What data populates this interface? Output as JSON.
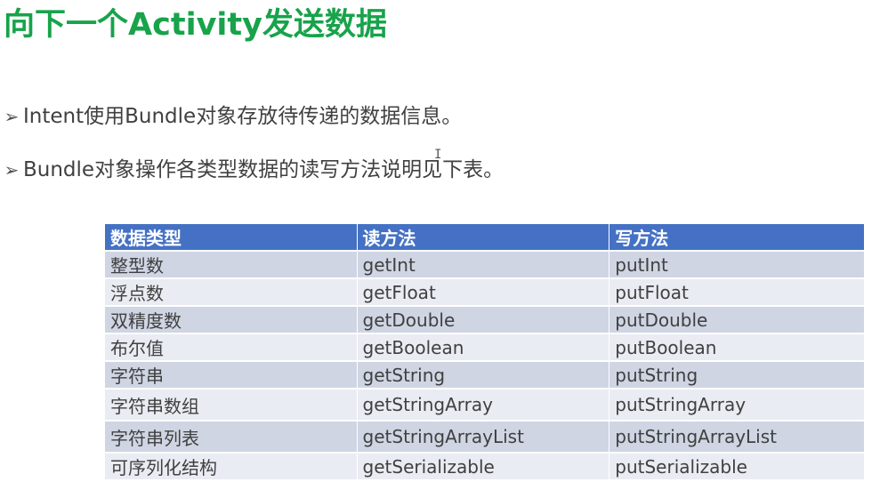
{
  "title": "向下一个Activity发送数据",
  "bullets": [
    {
      "marker": "➢",
      "text": "Intent使用Bundle对象存放待传递的数据信息。"
    },
    {
      "marker": "➢",
      "text": "Bundle对象操作各类型数据的读写方法说明见下表。"
    }
  ],
  "cursor_glyph": "I",
  "table": {
    "headers": [
      "数据类型",
      "读方法",
      "写方法"
    ],
    "rows": [
      [
        "整型数",
        "getInt",
        "putInt"
      ],
      [
        "浮点数",
        "getFloat",
        "putFloat"
      ],
      [
        "双精度数",
        "getDouble",
        "putDouble"
      ],
      [
        "布尔值",
        "getBoolean",
        "putBoolean"
      ],
      [
        "字符串",
        "getString",
        "putString"
      ],
      [
        "字符串数组",
        "getStringArray",
        "putStringArray"
      ],
      [
        "字符串列表",
        "getStringArrayList",
        "putStringArrayList"
      ],
      [
        "可序列化结构",
        "getSerializable",
        "putSerializable"
      ]
    ]
  },
  "colors": {
    "title": "#17a34a",
    "header_bg": "#4471c4",
    "row_dark": "#cfd5e3",
    "row_light": "#e9ecf2",
    "body_text": "#404040"
  }
}
